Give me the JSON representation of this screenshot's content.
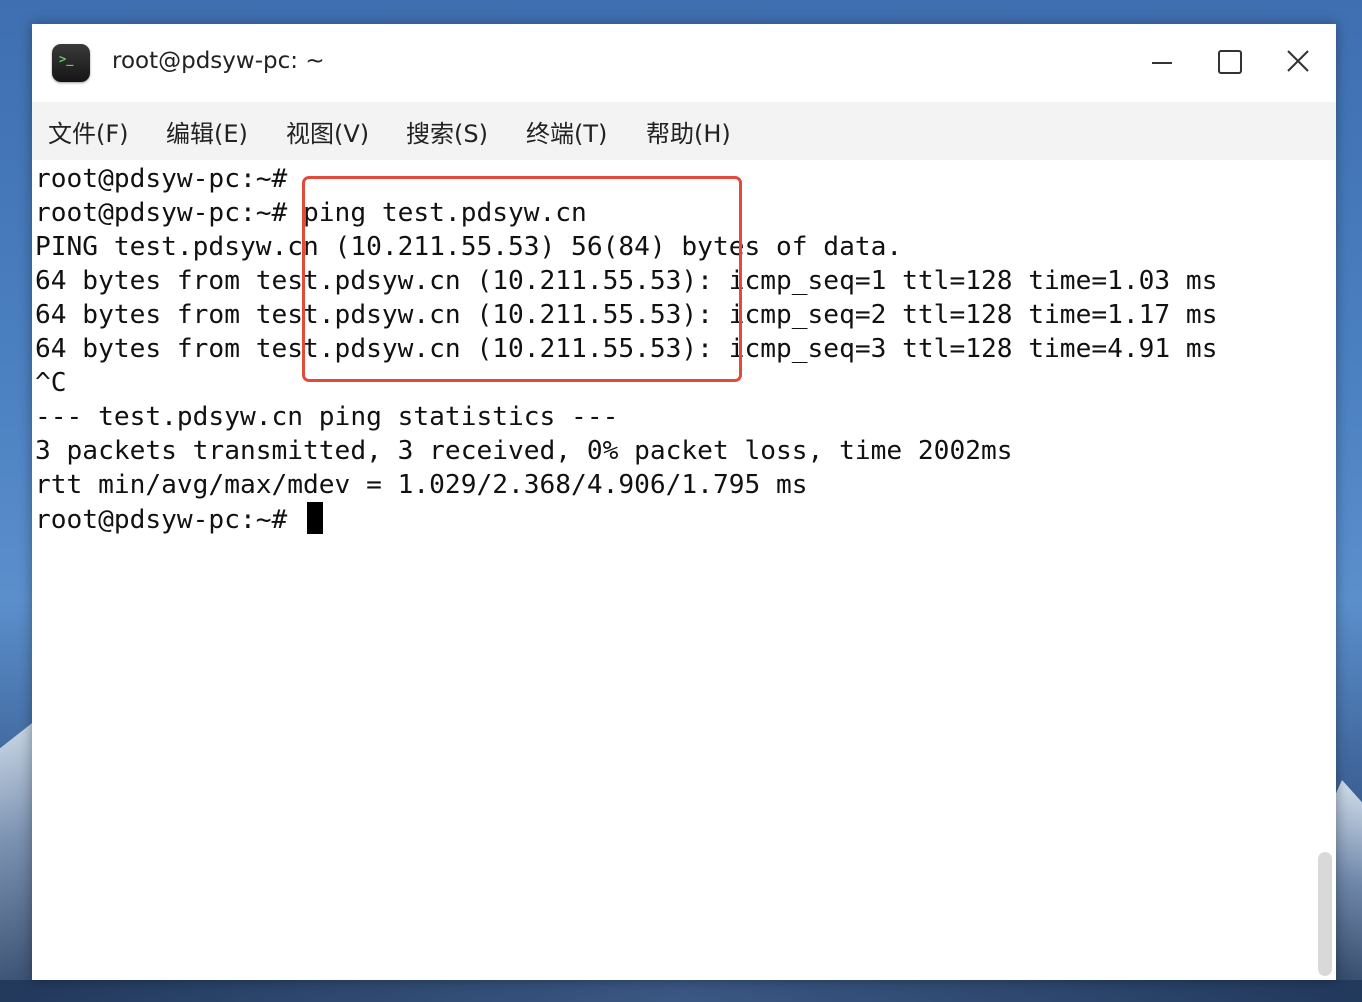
{
  "window": {
    "title": "root@pdsyw-pc: ~",
    "icon_glyph": ">_"
  },
  "window_controls": {
    "minimize_icon": "minimize-icon",
    "maximize_icon": "maximize-icon",
    "close_icon": "close-icon"
  },
  "menu": {
    "items": [
      {
        "label": "文件(F)"
      },
      {
        "label": "编辑(E)"
      },
      {
        "label": "视图(V)"
      },
      {
        "label": "搜索(S)"
      },
      {
        "label": "终端(T)"
      },
      {
        "label": "帮助(H)"
      }
    ]
  },
  "terminal": {
    "lines": [
      "root@pdsyw-pc:~#",
      "root@pdsyw-pc:~# ping test.pdsyw.cn",
      "PING test.pdsyw.cn (10.211.55.53) 56(84) bytes of data.",
      "64 bytes from test.pdsyw.cn (10.211.55.53): icmp_seq=1 ttl=128 time=1.03 ms",
      "64 bytes from test.pdsyw.cn (10.211.55.53): icmp_seq=2 ttl=128 time=1.17 ms",
      "64 bytes from test.pdsyw.cn (10.211.55.53): icmp_seq=3 ttl=128 time=4.91 ms",
      "^C",
      "--- test.pdsyw.cn ping statistics ---",
      "3 packets transmitted, 3 received, 0% packet loss, time 2002ms",
      "rtt min/avg/max/mdev = 1.029/2.368/4.906/1.795 ms",
      "root@pdsyw-pc:~# "
    ]
  },
  "colors": {
    "highlight_border": "#e24a3b",
    "terminal_text": "#111111",
    "terminal_bg": "#ffffff",
    "menubar_bg": "#f3f3f3"
  }
}
